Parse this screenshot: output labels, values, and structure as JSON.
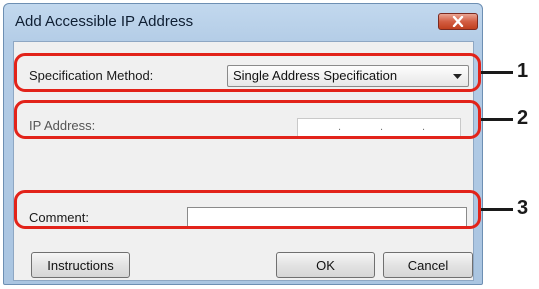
{
  "window": {
    "title": "Add Accessible IP Address"
  },
  "form": {
    "spec_method_label": "Specification Method:",
    "spec_method_value": "Single Address Specification",
    "ip_address_label": "IP Address:",
    "comment_label": "Comment:"
  },
  "buttons": {
    "instructions": "Instructions",
    "ok": "OK",
    "cancel": "Cancel"
  },
  "callouts": [
    "1",
    "2",
    "3"
  ],
  "colors": {
    "callout_border": "#e2231a",
    "title_bar": "#b3cce6",
    "close_button": "#d35e43"
  },
  "icons": [
    "close-icon",
    "dropdown-arrow-icon"
  ]
}
